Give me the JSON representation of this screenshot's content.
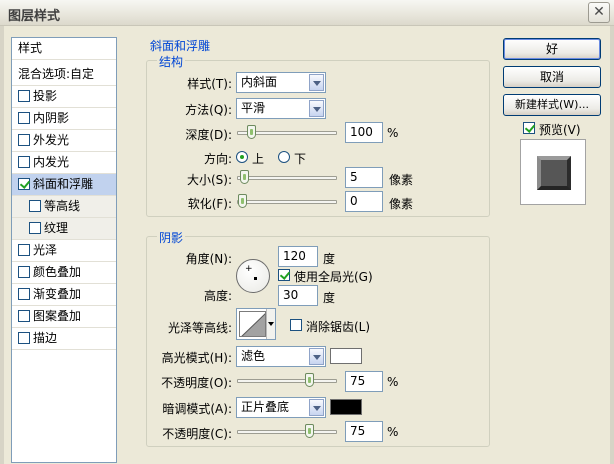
{
  "window": {
    "title": "图层样式",
    "close_glyph": "✕"
  },
  "sidebar": {
    "header": "样式",
    "blend": "混合选项:自定",
    "items": [
      {
        "label": "投影",
        "checked": false,
        "sub": false,
        "selected": false
      },
      {
        "label": "内阴影",
        "checked": false,
        "sub": false,
        "selected": false
      },
      {
        "label": "外发光",
        "checked": false,
        "sub": false,
        "selected": false
      },
      {
        "label": "内发光",
        "checked": false,
        "sub": false,
        "selected": false
      },
      {
        "label": "斜面和浮雕",
        "checked": true,
        "sub": false,
        "selected": true
      },
      {
        "label": "等高线",
        "checked": false,
        "sub": true,
        "selected": false
      },
      {
        "label": "纹理",
        "checked": false,
        "sub": true,
        "selected": false
      },
      {
        "label": "光泽",
        "checked": false,
        "sub": false,
        "selected": false
      },
      {
        "label": "颜色叠加",
        "checked": false,
        "sub": false,
        "selected": false
      },
      {
        "label": "渐变叠加",
        "checked": false,
        "sub": false,
        "selected": false
      },
      {
        "label": "图案叠加",
        "checked": false,
        "sub": false,
        "selected": false
      },
      {
        "label": "描边",
        "checked": false,
        "sub": false,
        "selected": false
      }
    ]
  },
  "bevel": {
    "section_title": "斜面和浮雕",
    "structure": {
      "title": "结构",
      "style_label": "样式(T):",
      "style_value": "内斜面",
      "technique_label": "方法(Q):",
      "technique_value": "平滑",
      "depth_label": "深度(D):",
      "depth_value": "100",
      "depth_unit": "%",
      "depth_fraction": 0.1,
      "direction_label": "方向:",
      "direction_up": "上",
      "direction_down": "下",
      "size_label": "大小(S):",
      "size_value": "5",
      "size_unit": "像素",
      "size_fraction": 0.02,
      "soften_label": "软化(F):",
      "soften_value": "0",
      "soften_unit": "像素",
      "soften_fraction": 0.0
    },
    "shading": {
      "title": "阴影",
      "angle_label": "角度(N):",
      "angle_value": "120",
      "angle_unit": "度",
      "global_light_label": "使用全局光(G)",
      "global_light_checked": true,
      "altitude_label": "高度:",
      "altitude_value": "30",
      "altitude_unit": "度",
      "gloss_contour_label": "光泽等高线:",
      "antialias_label": "消除锯齿(L)",
      "antialias_checked": false,
      "highlight_mode_label": "高光模式(H):",
      "highlight_mode_value": "滤色",
      "highlight_color": "#ffffff",
      "highlight_opacity_label": "不透明度(O):",
      "highlight_opacity_value": "75",
      "highlight_opacity_unit": "%",
      "highlight_opacity_fraction": 0.75,
      "shadow_mode_label": "暗调模式(A):",
      "shadow_mode_value": "正片叠底",
      "shadow_color": "#000000",
      "shadow_opacity_label": "不透明度(C):",
      "shadow_opacity_value": "75",
      "shadow_opacity_unit": "%",
      "shadow_opacity_fraction": 0.75
    }
  },
  "buttons": {
    "ok": "好",
    "cancel": "取消",
    "new_style": "新建样式(W)...",
    "preview_label": "预览(V)",
    "preview_checked": true
  },
  "colors": {
    "accent": "#0046d5",
    "selected_row": "#c1d2ee"
  }
}
